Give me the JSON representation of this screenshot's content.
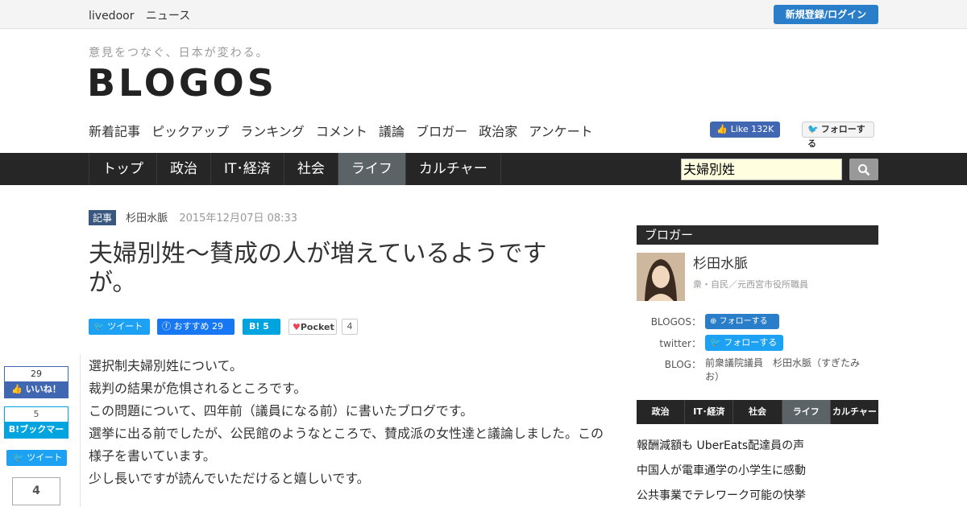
{
  "topbar": {
    "brand": "livedoor",
    "news": "ニュース",
    "login": "新規登録/ログイン"
  },
  "header": {
    "tagline": "意見をつなぐ、日本が変わる。",
    "logo": "BLOGOS"
  },
  "subnav": [
    "新着記事",
    "ピックアップ",
    "ランキング",
    "コメント",
    "議論",
    "ブロガー",
    "政治家",
    "アンケート"
  ],
  "social": {
    "fb_like_label": "Like",
    "fb_like_count": "132K",
    "tw_follow": "フォローする"
  },
  "catnav": {
    "items": [
      "トップ",
      "政治",
      "IT･経済",
      "社会",
      "ライフ",
      "カルチャー"
    ],
    "active": "ライフ"
  },
  "search": {
    "value": "夫婦別姓"
  },
  "article": {
    "tag": "記事",
    "author": "杉田水脈",
    "date": "2015年12月07日 08:33",
    "title": "夫婦別姓〜賛成の人が増えているようですが。",
    "share": {
      "tweet": "ツイート",
      "fb": "おすすめ",
      "fb_count": "29",
      "hb": "B!",
      "hb_count": "5",
      "pocket": "Pocket",
      "pocket_count": "4"
    },
    "paragraphs": [
      "選択制夫婦別姓について。",
      "裁判の結果が危惧されるところです。",
      "この問題について、四年前（議員になる前）に書いたブログです。",
      "選挙に出る前でしたが、公民館のようなところで、賛成派の女性達と議論しました。この様子を書いています。",
      "少し長いですが読んでいただけると嬉しいです。"
    ]
  },
  "side_share": {
    "fb_count": "29",
    "fb_label": "いいね！",
    "hb_count": "5",
    "hb_label": "B!ブックマーク",
    "tweet": "ツイート",
    "pocket_count": "4"
  },
  "sidebar": {
    "heading": "ブロガー",
    "blogger_name": "杉田水脈",
    "blogger_desc": "衆・自民／元西宮市役所職員",
    "blogos_label": "BLOGOS：",
    "blogos_follow": "フォローする",
    "twitter_label": "twitter：",
    "twitter_follow": "フォローする",
    "blog_label": "BLOG：",
    "blog_name": "前衆議院議員　杉田水脈（すぎたみお）",
    "tabs": [
      "政治",
      "IT･経済",
      "社会",
      "ライフ",
      "カルチャー"
    ],
    "active_tab": "ライフ",
    "news": [
      "報酬減額も UberEats配達員の声",
      "中国人が電車通学の小学生に感動",
      "公共事業でテレワーク可能の快挙"
    ]
  }
}
